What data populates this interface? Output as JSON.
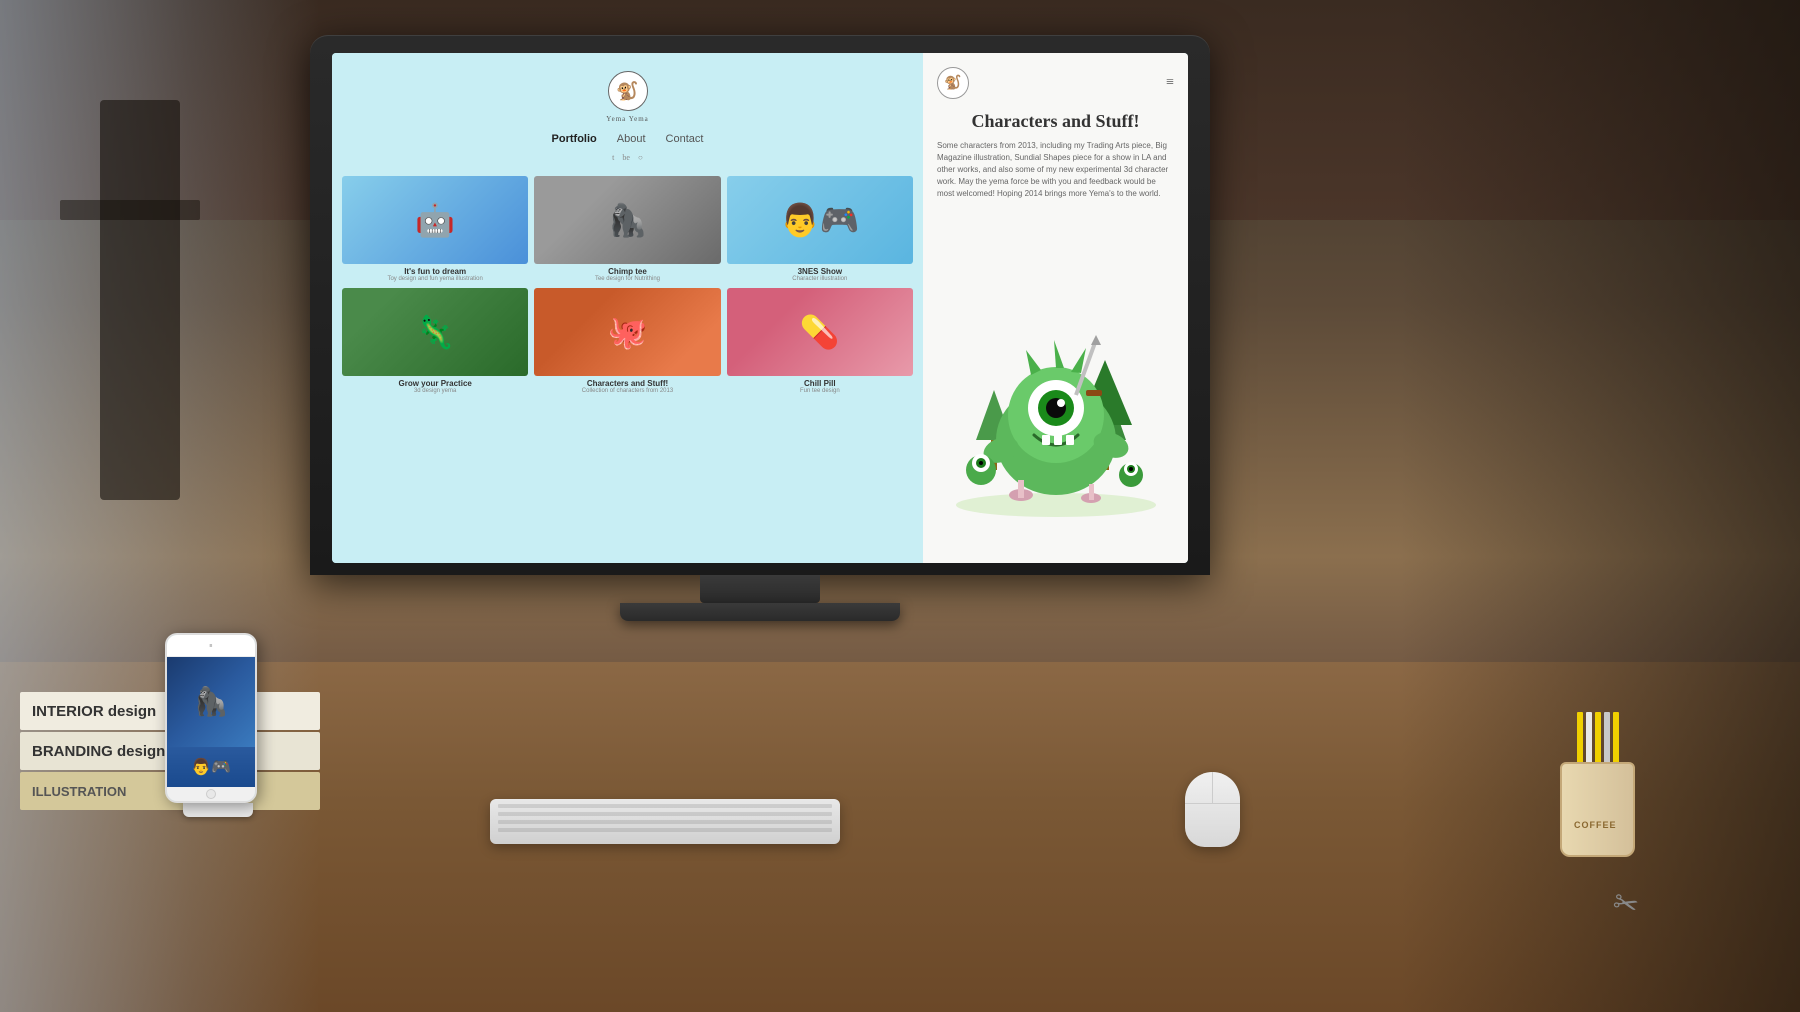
{
  "scene": {
    "title": "Designer Portfolio Website on iMac"
  },
  "monitor": {
    "left_panel": {
      "logo_emoji": "🐒",
      "logo_text": "Yema Yema",
      "nav": [
        {
          "label": "Portfolio",
          "active": true
        },
        {
          "label": "About",
          "active": false
        },
        {
          "label": "Contact",
          "active": false
        }
      ],
      "social_icons": [
        "t",
        "be",
        "○"
      ],
      "portfolio_items": [
        {
          "title": "It's fun to dream",
          "subtitle": "Toy design and fun yema illustration",
          "color": "thumb-1"
        },
        {
          "title": "Chimp tee",
          "subtitle": "Tee design for Nutrithing",
          "color": "thumb-2"
        },
        {
          "title": "3NES Show",
          "subtitle": "Character illustration",
          "color": "thumb-3"
        },
        {
          "title": "Grow your Practice",
          "subtitle": "3d design yema",
          "color": "thumb-4"
        },
        {
          "title": "Characters and Stuff!",
          "subtitle": "Collection of characters from 2013",
          "color": "thumb-5"
        },
        {
          "title": "Chill Pill",
          "subtitle": "Fun tee design",
          "color": "thumb-6"
        }
      ]
    },
    "right_panel": {
      "logo_emoji": "🐒",
      "hamburger": "≡",
      "title": "Characters and Stuff!",
      "body_text": "Some characters from 2013, including my Trading Arts piece, Big Magazine illustration, Sundial Shapes piece for a show in LA and other works, and also some of my new experimental 3d character work. May the yema force be with you and feedback would be most welcomed! Hoping 2014 brings more Yema's to the world.",
      "monster_emoji": "👾"
    }
  },
  "books": [
    {
      "label": "INTERIOR design",
      "class": "book-1"
    },
    {
      "label": "BRANDING design",
      "class": "book-2"
    },
    {
      "label": "ILLUSTRATION",
      "class": "book-3"
    }
  ],
  "cup_label": "COFFEE",
  "thumbnail_emojis": [
    "🤖",
    "🦍",
    "👨‍🎮",
    "🦎",
    "🐙",
    "💊"
  ]
}
